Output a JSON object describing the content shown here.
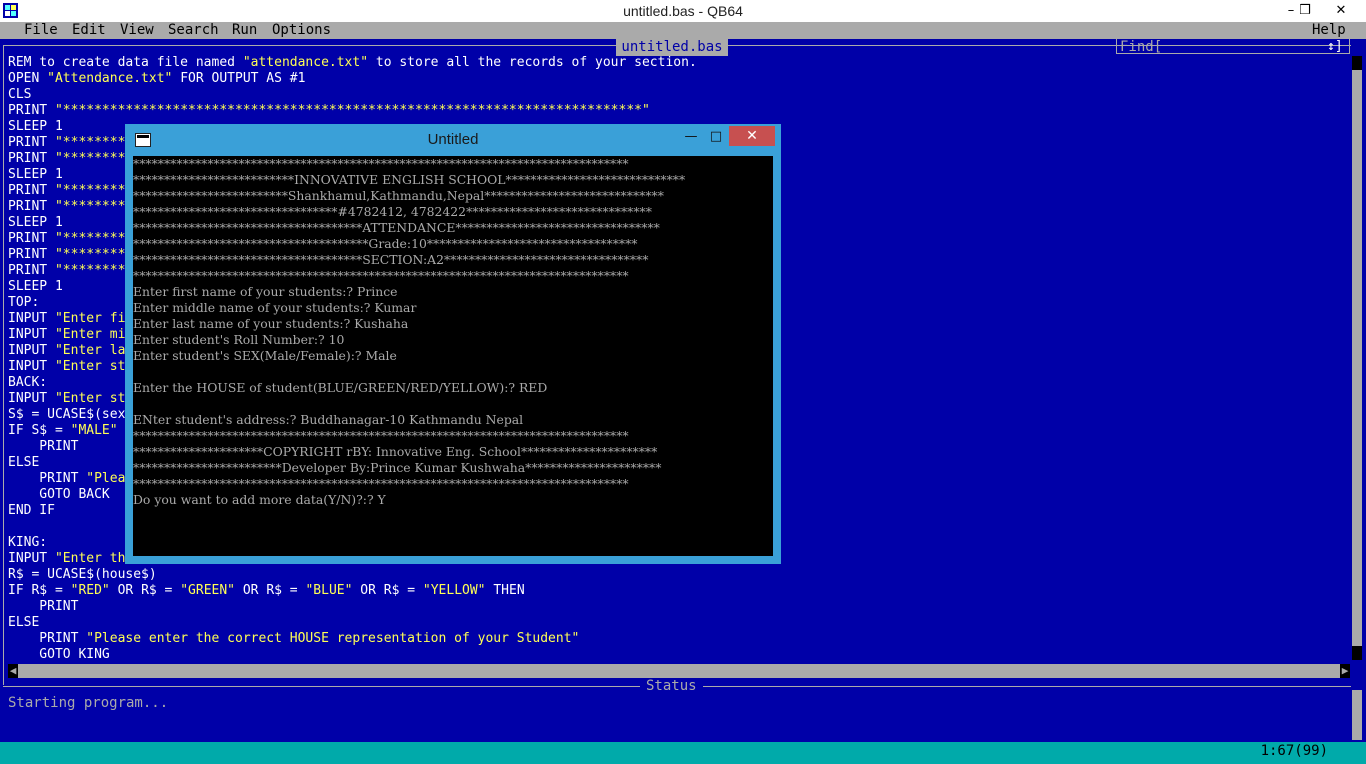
{
  "window": {
    "title": "untitled.bas - QB64",
    "minimize": "–",
    "restore": "❒",
    "close": "✕"
  },
  "menu": [
    "File",
    "Edit",
    "View",
    "Search",
    "Run",
    "Options"
  ],
  "help_menu": "Help",
  "editor": {
    "file_tab": "untitled.bas",
    "find_label": "Find[",
    "find_arrows": "↕]",
    "code_lines": [
      "REM to create data file named \"attendance.txt\" to store all the records of your section.",
      "OPEN \"Attendance.txt\" FOR OUTPUT AS #1",
      "CLS",
      "PRINT \"**************************************************************************\"",
      "SLEEP 1",
      "PRINT \"********",
      "PRINT \"********",
      "SLEEP 1",
      "PRINT \"********",
      "PRINT \"********",
      "SLEEP 1",
      "PRINT \"********",
      "PRINT \"********",
      "PRINT \"********",
      "SLEEP 1",
      "TOP:",
      "INPUT \"Enter fi",
      "INPUT \"Enter mi",
      "INPUT \"Enter la",
      "INPUT \"Enter st",
      "BACK:",
      "INPUT \"Enter st",
      "S$ = UCASE$(sex",
      "IF S$ = \"MALE\"",
      "    PRINT",
      "ELSE",
      "    PRINT \"Plea",
      "    GOTO BACK",
      "END IF",
      "",
      "KING:",
      "INPUT \"Enter th",
      "R$ = UCASE$(house$)",
      "IF R$ = \"RED\" OR R$ = \"GREEN\" OR R$ = \"BLUE\" OR R$ = \"YELLOW\" THEN",
      "    PRINT",
      "ELSE",
      "    PRINT \"Please enter the correct HOUSE representation of your Student\"",
      "    GOTO KING"
    ]
  },
  "status": {
    "label": "Status",
    "text": "Starting program..."
  },
  "cursor_position": "1:67(99)",
  "run_window": {
    "title": "Untitled",
    "minimize": "—",
    "maximize": "□",
    "close": "✕",
    "console_lines": [
      "********************************************************************************",
      "**************************INNOVATIVE ENGLISH SCHOOL*****************************",
      "*************************Shankhamul,Kathmandu,Nepal*****************************",
      "*********************************#4782412, 4782422******************************",
      "*************************************ATTENDANCE*********************************",
      "**************************************Grade:10**********************************",
      "*************************************SECTION:A2*********************************",
      "********************************************************************************",
      "Enter first name of your students:? Prince",
      "Enter middle name of your students:? Kumar",
      "Enter last name of your students:? Kushaha",
      "Enter student's Roll Number:? 10",
      "Enter student's SEX(Male/Female):? Male",
      "",
      "Enter the HOUSE of student(BLUE/GREEN/RED/YELLOW):? RED",
      "",
      "ENter student's address:? Buddhanagar-10 Kathmandu Nepal",
      "********************************************************************************",
      "*********************COPYRIGHT rBY: Innovative Eng. School**********************",
      "************************Developer By:Prince Kumar Kushwaha**********************",
      "********************************************************************************",
      "Do you want to add more data(Y/N)?:? Y"
    ]
  }
}
